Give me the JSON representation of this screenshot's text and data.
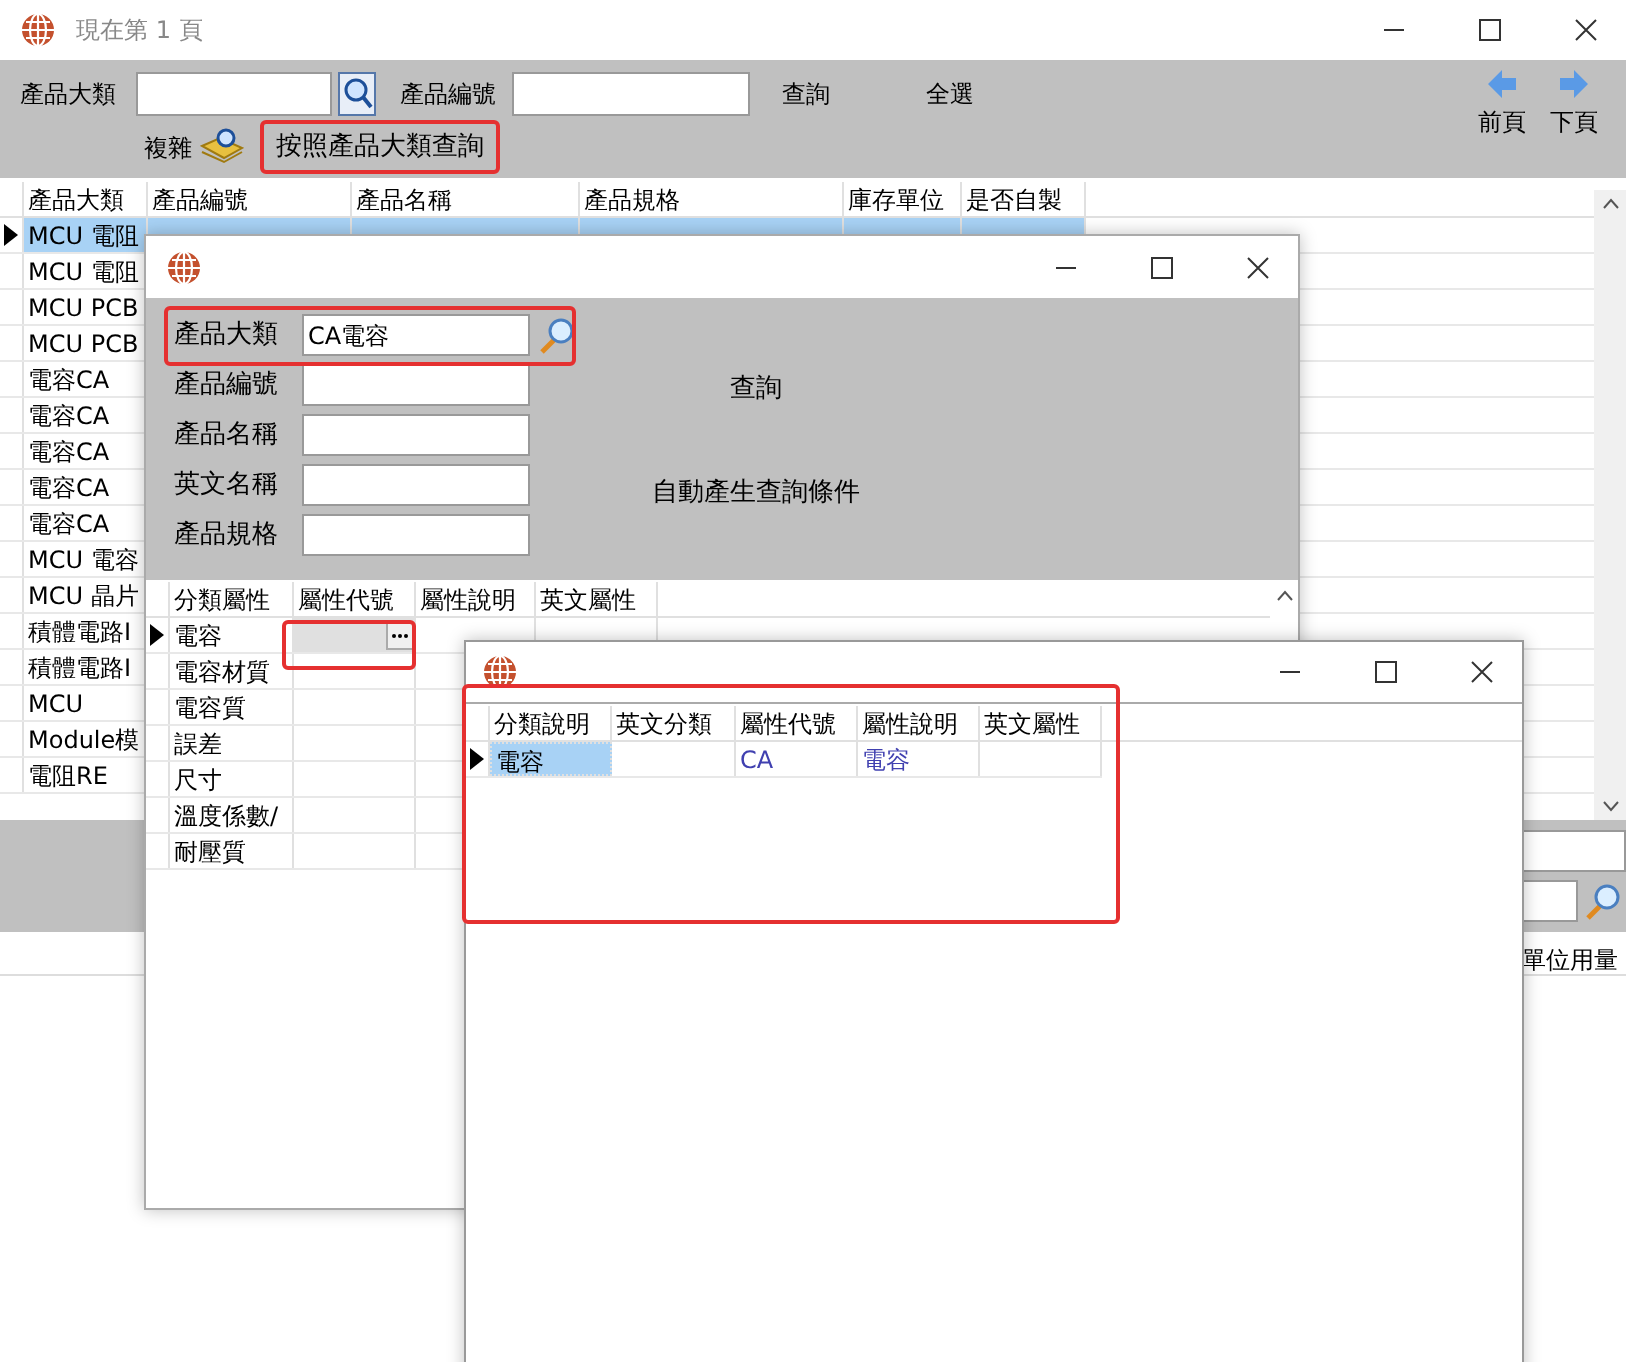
{
  "main_window": {
    "title": "現在第 1 頁",
    "toolbar": {
      "category_label": "產品大類",
      "number_label": "產品編號",
      "query_button": "查詢",
      "select_all_button": "全選",
      "complex_label": "複雜",
      "category_query_button": "按照產品大類查詢",
      "prev_page": "前頁",
      "next_page": "下頁"
    },
    "grid": {
      "columns": [
        "產品大類",
        "產品編號",
        "產品名稱",
        "產品規格",
        "庫存單位",
        "是否自製"
      ],
      "rows": [
        {
          "selected": true,
          "category": "MCU 電阻"
        },
        {
          "selected": false,
          "category": "MCU 電阻"
        },
        {
          "selected": false,
          "category": "MCU PCB"
        },
        {
          "selected": false,
          "category": "MCU PCB"
        },
        {
          "selected": false,
          "category": "電容CA"
        },
        {
          "selected": false,
          "category": "電容CA"
        },
        {
          "selected": false,
          "category": "電容CA"
        },
        {
          "selected": false,
          "category": "電容CA"
        },
        {
          "selected": false,
          "category": "電容CA"
        },
        {
          "selected": false,
          "category": "MCU 電容"
        },
        {
          "selected": false,
          "category": "MCU 晶片"
        },
        {
          "selected": false,
          "category": "積體電路I"
        },
        {
          "selected": false,
          "category": "積體電路I"
        },
        {
          "selected": false,
          "category": "MCU"
        },
        {
          "selected": false,
          "category": "Module模"
        },
        {
          "selected": false,
          "category": "電阻RE"
        }
      ]
    },
    "lower_panel": {
      "column_header": "單位用量"
    }
  },
  "query_window": {
    "fields": [
      {
        "label": "產品大類",
        "value": "CA電容"
      },
      {
        "label": "產品編號"
      },
      {
        "label": "產品名稱"
      },
      {
        "label": "英文名稱"
      },
      {
        "label": "產品規格"
      }
    ],
    "query_button": "查詢",
    "auto_condition_button": "自動產生查詢條件",
    "grid": {
      "columns": [
        "分類屬性",
        "屬性代號",
        "屬性說明",
        "英文屬性"
      ],
      "rows": [
        {
          "selected": true,
          "name": "電容"
        },
        {
          "selected": false,
          "name": "電容材質"
        },
        {
          "selected": false,
          "name": "電容質"
        },
        {
          "selected": false,
          "name": "誤差"
        },
        {
          "selected": false,
          "name": "尺寸"
        },
        {
          "selected": false,
          "name": "溫度係數/"
        },
        {
          "selected": false,
          "name": "耐壓質"
        }
      ]
    }
  },
  "lookup_window": {
    "grid": {
      "columns": [
        "分類說明",
        "英文分類",
        "屬性代號",
        "屬性說明",
        "英文屬性"
      ],
      "rows": [
        {
          "selected": true,
          "category": "電容",
          "code": "CA",
          "description": "電容"
        }
      ]
    }
  }
}
